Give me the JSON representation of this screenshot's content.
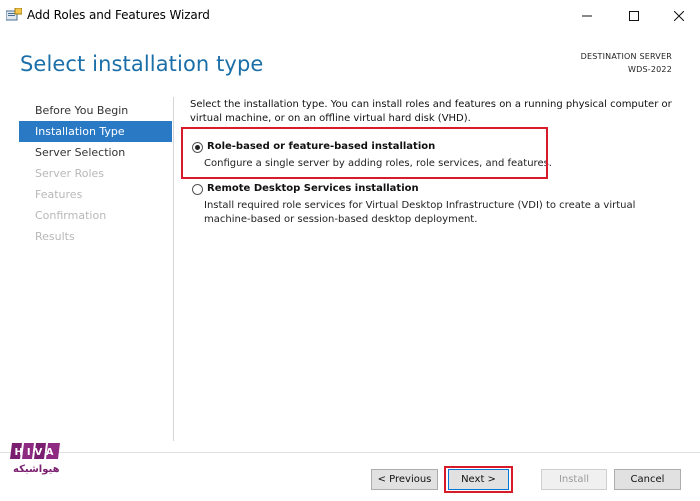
{
  "window": {
    "title": "Add Roles and Features Wizard",
    "icons": {
      "app": "server-manager-icon",
      "minimize": "minimize-icon",
      "maximize": "maximize-icon",
      "close": "close-icon"
    }
  },
  "header": {
    "page_title": "Select installation type",
    "destination_label": "DESTINATION SERVER",
    "destination_value": "WDS-2022"
  },
  "nav": {
    "items": [
      {
        "label": "Before You Begin",
        "state": "normal"
      },
      {
        "label": "Installation Type",
        "state": "active"
      },
      {
        "label": "Server Selection",
        "state": "normal"
      },
      {
        "label": "Server Roles",
        "state": "disabled"
      },
      {
        "label": "Features",
        "state": "disabled"
      },
      {
        "label": "Confirmation",
        "state": "disabled"
      },
      {
        "label": "Results",
        "state": "disabled"
      }
    ]
  },
  "content": {
    "intro": "Select the installation type. You can install roles and features on a running physical computer or virtual machine, or on an offline virtual hard disk (VHD).",
    "options": [
      {
        "title": "Role-based or feature-based installation",
        "description": "Configure a single server by adding roles, role services, and features.",
        "selected": true
      },
      {
        "title": "Remote Desktop Services installation",
        "description": "Install required role services for Virtual Desktop Infrastructure (VDI) to create a virtual machine-based or session-based desktop deployment.",
        "selected": false
      }
    ]
  },
  "footer": {
    "previous_label": "< Previous",
    "next_label": "Next >",
    "install_label": "Install",
    "cancel_label": "Cancel"
  },
  "logo": {
    "text": "هیواشبکه",
    "letters": "HIVA"
  },
  "colors": {
    "accent": "#2a79c4",
    "title_blue": "#1b6fa8",
    "highlight_red": "#d81b2a",
    "logo_purple": "#7a1f6f"
  }
}
